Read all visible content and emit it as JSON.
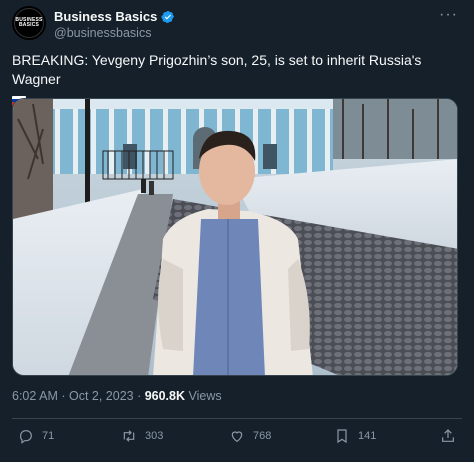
{
  "account": {
    "display_name": "Business Basics",
    "handle": "@businessbasics",
    "avatar_text_line1": "BUSINESS",
    "avatar_text_line2": "BASICS"
  },
  "tweet": {
    "text": "BREAKING: Yevgeny Prigozhin’s son, 25, is set to inherit Russia's Wagner",
    "flag_emoji": "russia-flag"
  },
  "meta": {
    "time_date": "6:02 AM · Oct 2, 2023 · ",
    "views_count": "960.8K",
    "views_label": " Views"
  },
  "actions": {
    "replies": "71",
    "reposts": "303",
    "likes": "768",
    "bookmarks": "141"
  },
  "colors": {
    "background": "#15202b",
    "text_primary": "#f7f9f9",
    "text_secondary": "#8b98a5",
    "verified": "#1d9bf0",
    "divider": "#38444d"
  },
  "icons": [
    "verified-badge-icon",
    "more-icon",
    "reply-icon",
    "repost-icon",
    "like-icon",
    "bookmark-icon",
    "share-icon"
  ]
}
